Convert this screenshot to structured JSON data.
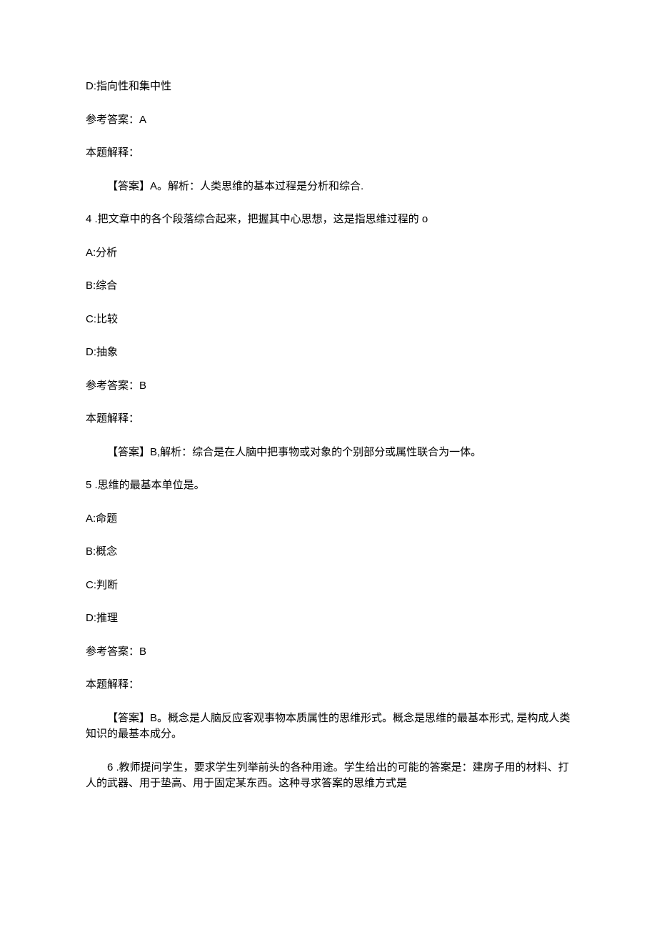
{
  "q3_tail": {
    "optD": "D:指向性和集中性",
    "ref_ans": "参考答案：A",
    "explain_label": "本题解释：",
    "explain_text": "【答案】A。解析：人类思维的基本过程是分析和综合."
  },
  "q4": {
    "stem": "4 .把文章中的各个段落综合起来，把握其中心思想，这是指思维过程的 o",
    "optA": "A:分析",
    "optB": "B:综合",
    "optC": "C:比较",
    "optD": "D:抽象",
    "ref_ans": "参考答案：B",
    "explain_label": "本题解释：",
    "explain_text": "【答案】B,解析：综合是在人脑中把事物或对象的个别部分或属性联合为一体。"
  },
  "q5": {
    "stem": "5 .思维的最基本单位是。",
    "optA": "A:命题",
    "optB": "B:概念",
    "optC": "C:判断",
    "optD": "D:推理",
    "ref_ans": "参考答案：B",
    "explain_label": "本题解释：",
    "explain_text": "【答案】B。概念是人脑反应客观事物本质属性的思维形式。概念是思维的最基本形式, 是构成人类知识的最基本成分。"
  },
  "q6": {
    "stem": "6 .教师提问学生，要求学生列举前头的各种用途。学生给出的可能的答案是：建房子用的材料、打人的武器、用于垫高、用于固定某东西。这种寻求答案的思维方式是"
  }
}
